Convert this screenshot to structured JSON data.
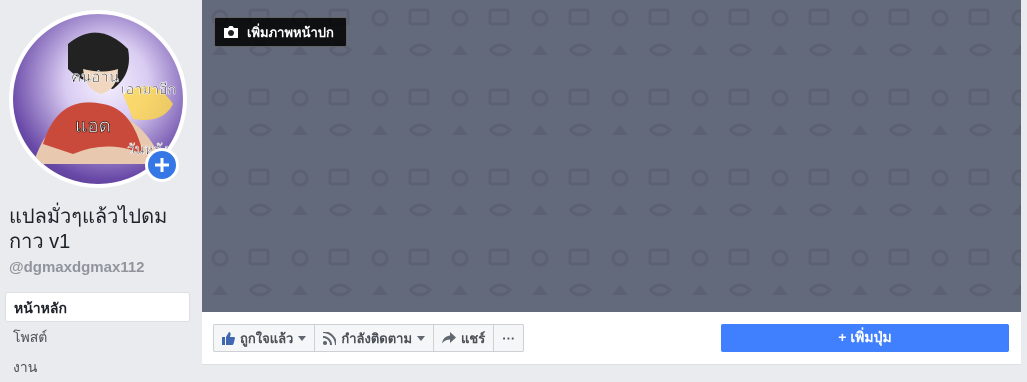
{
  "profile": {
    "name": "แปลมั่วๆแล้วไปดมกาว v1",
    "username": "@dgmaxdgmax112",
    "avatar_text": [
      "คนอ่าน",
      "เอามาอีก",
      "แอด",
      "วันหลัง"
    ]
  },
  "sidebar": {
    "items": [
      {
        "label": "หน้าหลัก",
        "active": true
      },
      {
        "label": "โพสต์"
      },
      {
        "label": "งาน"
      }
    ]
  },
  "cover": {
    "add_cover_label": "เพิ่มภาพหน้าปก",
    "icon": "camera-icon"
  },
  "actions": {
    "like_label": "ถูกใจแล้ว",
    "follow_label": "กำลังติดตาม",
    "share_label": "แชร์",
    "more_label": "···",
    "add_button_label": "+ เพิ่มปุ่ม"
  },
  "colors": {
    "accent": "#4080ff",
    "cover": "#636a7b",
    "background": "#e9ebee"
  }
}
